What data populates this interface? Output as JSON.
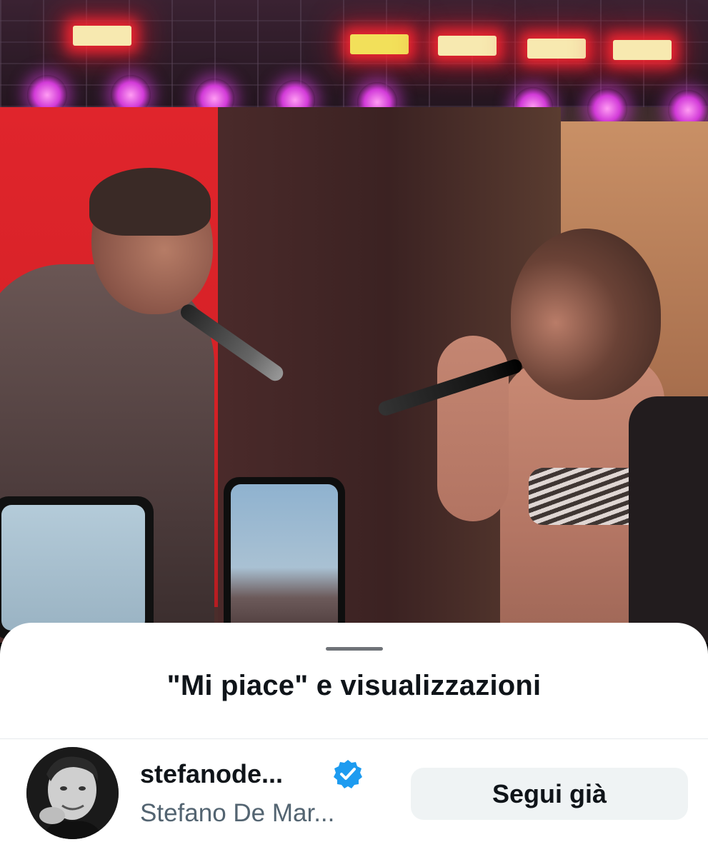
{
  "sheet": {
    "title": "\"Mi piace\" e visualizzazioni"
  },
  "user": {
    "display_name": "stefanode...",
    "handle": "Stefano De Mar...",
    "verified": true,
    "verified_badge_color": "#1d9bf0",
    "avatar_icon": "profile-photo"
  },
  "follow_button": {
    "label": "Segui già"
  },
  "colors": {
    "sheet_background": "#ffffff",
    "title_text": "#0f1419",
    "secondary_text": "#536471",
    "button_background": "#eff3f4",
    "grabber": "#6f7378"
  }
}
